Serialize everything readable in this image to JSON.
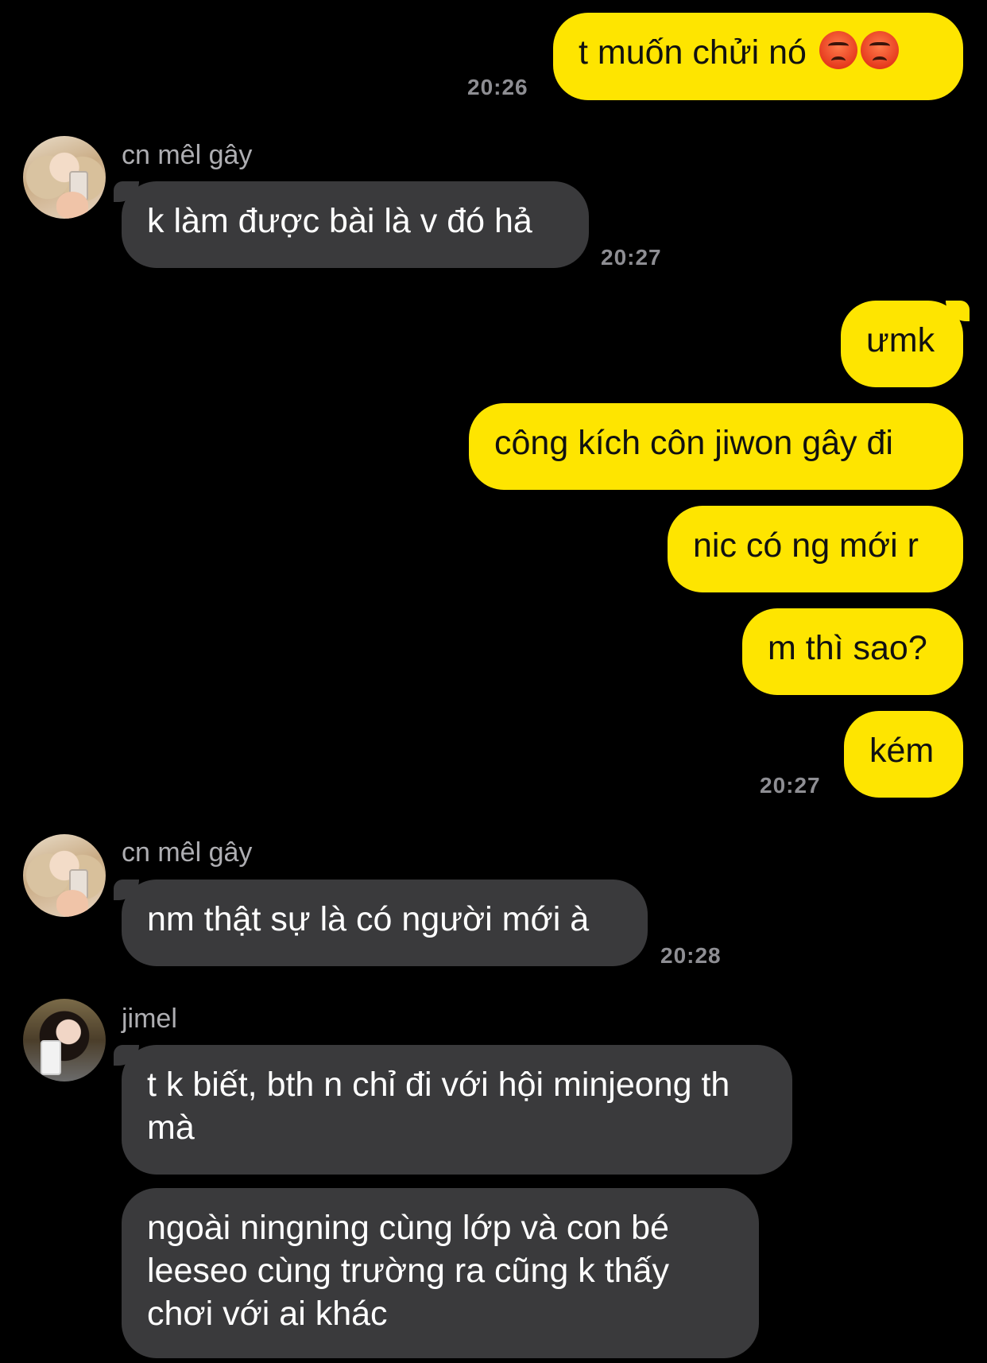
{
  "messages": {
    "m1": {
      "text": "t muốn chửi nó",
      "emoji": [
        "angry-face",
        "angry-face"
      ],
      "time": "20:26"
    },
    "m2": {
      "sender": "cn mêl gây",
      "text": "k làm được bài là v đó hả",
      "time": "20:27"
    },
    "m3": {
      "text": "ưmk"
    },
    "m4": {
      "text": "công kích côn jiwon gây đi"
    },
    "m5": {
      "text": "nic có ng mới r"
    },
    "m6": {
      "text": "m thì sao?"
    },
    "m7": {
      "text": "kém",
      "time": "20:27"
    },
    "m8": {
      "sender": "cn mêl gây",
      "text": "nm thật sự là có người mới à",
      "time": "20:28"
    },
    "m9": {
      "sender": "jimel",
      "text": "t k biết, bth n chỉ đi với hội minjeong th mà"
    },
    "m10": {
      "text": "ngoài ningning cùng lớp và con bé leeseo cùng trường ra cũng k thấy chơi với ai khác"
    }
  },
  "colors": {
    "background": "#000000",
    "my_bubble": "#FEE500",
    "their_bubble": "#3A3A3C",
    "timestamp": "#8E8E93"
  }
}
